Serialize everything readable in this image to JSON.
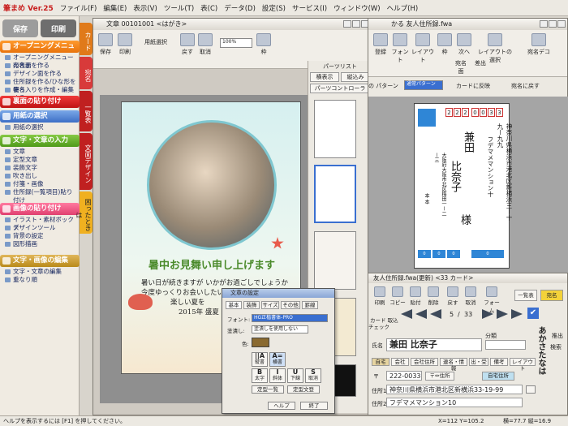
{
  "app": {
    "title": "筆まめ Ver.25"
  },
  "menu": [
    "ファイル(F)",
    "編集(E)",
    "表示(V)",
    "ツール(T)",
    "表(C)",
    "データ(D)",
    "設定(S)",
    "サービス(I)",
    "ウィンドウ(W)",
    "ヘルプ(H)"
  ],
  "launcher": {
    "save": "保存",
    "print": "印刷",
    "sections": [
      {
        "title": "オープニングメニュー",
        "items": [
          "オープニングメニューの表示",
          "宛名面を作る",
          "デザイン面を作る",
          "住所録を作る/ひな形を使う",
          "署名入りを作成・編集する"
        ]
      },
      {
        "title": "裏面の貼り付け",
        "items": []
      },
      {
        "title": "用紙の選択",
        "items": [
          "用紙の選択"
        ]
      },
      {
        "title": "文字・文章の入力",
        "items": [
          "文章",
          "定型文章",
          "装飾文字",
          "吹き出し",
          "付箋・画像",
          "住所録(一覧項目)貼り付け"
        ]
      },
      {
        "title": "画像の貼り付け",
        "items": [
          "イラスト・素材ボックス",
          "デザインツール",
          "背景の設定",
          "図形描画"
        ]
      },
      {
        "title": "文字・画像の編集",
        "items": [
          "文字・文章の編集",
          "重なり順"
        ]
      }
    ],
    "vtabs": [
      "カード",
      "宛名",
      "一覧表",
      "文面デザイン",
      "困ったときは"
    ]
  },
  "doc": {
    "title": "文章  00101001 <はがき>",
    "tools": [
      "保存",
      "印刷",
      "用紙選択",
      "戻す",
      "取消",
      "100%",
      "枠"
    ],
    "zoom": "100%",
    "greeting": "暑中お見舞い申し上げます",
    "message": [
      "暑い日が続きますが いかがお過ごしでしょうか",
      "今度ゆっくりお会いしたいですね",
      "楽しい夏を",
      "2015年 盛夏"
    ],
    "preview_title": "パーツリスト",
    "preview_buttons": [
      "横表示",
      "縦込み",
      "パーツコントローラ"
    ]
  },
  "text_dialog": {
    "title": "文章の設定",
    "tabs": [
      "基本",
      "装飾",
      "サイズ",
      "その他",
      "罫線"
    ],
    "font_label": "フォント:",
    "font_value": "HG正楷書体-PRO",
    "fill_label": "塗潰し:",
    "fill_value": "塗潰しを使用しない",
    "color_label": "色:",
    "buttons": [
      "縦書",
      "横書",
      "太字",
      "斜体",
      "下線",
      "取消"
    ],
    "button_glyphs": [
      "||A",
      "A=",
      "B",
      "I",
      "U",
      "S"
    ],
    "align_buttons": [
      "定型一覧",
      "定型文登"
    ],
    "help": "ヘルプ",
    "close": "終了"
  },
  "addr": {
    "title": "かる  友人住所録.fwa",
    "tools": [
      "登録",
      "フォント",
      "レイアウト",
      "枠",
      "戻す",
      "取消",
      "次へ",
      "宛名面",
      "差出",
      "カードに反映",
      "宛名デコ",
      "レイアウトの選択"
    ],
    "pattern_label": "の パターン",
    "pattern_value": "通常パターン",
    "reflect_label": "カードに反映",
    "default_label": "宛名に戻す",
    "card": {
      "zip": [
        "2",
        "2",
        "2",
        "0",
        "0",
        "3",
        "3"
      ],
      "address": "神奈川県横浜市港北区新横浜三ー十九ー九九",
      "building": "フデマメマンション十",
      "surname": "兼田",
      "given": "比奈子",
      "honorific": "様",
      "sender_name": "本 本",
      "sender_addr": "大阪府大阪市北区梅田一ー二ー三",
      "sender_zip": [
        "0",
        "0",
        "0",
        "0",
        "0",
        "0",
        "0"
      ]
    }
  },
  "entry": {
    "title": "友人住所録.fwa(更新)  <33 カード>",
    "tools": [
      "印刷",
      "コピー",
      "貼付",
      "削除",
      "戻す",
      "取消",
      "フォーム"
    ],
    "side_buttons": [
      "一覧表",
      "宛名"
    ],
    "nav": [
      "先頭",
      "前頁",
      "前へ",
      "次へ",
      "次頁",
      "最終",
      "チェック"
    ],
    "page": "5",
    "total": "33",
    "search_label": "カード 取込",
    "name_label": "氏名",
    "name_value": "兼田 比奈子",
    "furigana": "かねだ ひなこ",
    "kana_index": "あかさたなは",
    "kana_head": "検索",
    "chips": [
      "自宅",
      "会社",
      "会社住所",
      "連名・情報",
      "出・受",
      "備考",
      "レイアウト"
    ],
    "zip_label": "〒",
    "zip_value": "222-0033",
    "zip_button": "〒⇔住所",
    "home_label": "自宅住所",
    "addr1_label": "住所1",
    "addr1_value": "神奈川県横浜市港北区新横浜33-19-99",
    "addr2_label": "住所2",
    "addr2_value": "フデマメマンション10",
    "col1": "分類",
    "col2": "推出"
  },
  "status": {
    "left": "ヘルプを表示するには [F1] を押してください。",
    "coords": "X=112 Y=105.2",
    "size": "横=77.7 縦=16.9"
  }
}
